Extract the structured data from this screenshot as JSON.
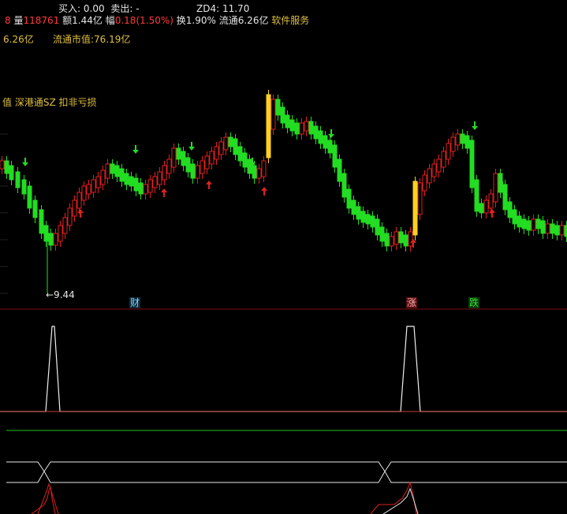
{
  "header": {
    "buy_label": "买入:",
    "buy_value": "0.00",
    "sell_label": "卖出:",
    "sell_value": "-",
    "zd4_label": "ZD4:",
    "zd4_value": "11.70",
    "row2_prefix": "8",
    "volume_label": "量",
    "volume_value": "118761",
    "amount_label": "额",
    "amount_value": "1.44亿",
    "amplitude_label": "幅",
    "amplitude_value": "0.18(1.50%)",
    "turnover_label": "换",
    "turnover_value": "1.90%",
    "float_label": "流通",
    "float_value": "6.26亿",
    "sector": "软件服务",
    "row3_left": "6.26亿",
    "float_mktcap_label": "流通市值:",
    "float_mktcap_value": "76.19亿"
  },
  "tags": {
    "prefix": "值",
    "stock_connect": "深港通SZ",
    "loss": "扣非亏损"
  },
  "annotations": {
    "low_price": "←9.44",
    "events": [
      "财",
      "涨",
      "跌"
    ]
  },
  "colors": {
    "background": "#000000",
    "up": "#e02020",
    "down": "#22dd22",
    "limit": "#ffd020",
    "separator": "#7a1010",
    "green_line": "#1a9a1a"
  },
  "chart_data": {
    "type": "candlestick",
    "price_axis_visible": false,
    "low_marker": 9.44,
    "arrows_down": [
      5,
      34,
      47,
      63,
      82,
      116,
      125
    ],
    "arrows_up": [
      19,
      40,
      52,
      66,
      103,
      122
    ],
    "indicator_spikes": [
      13,
      102
    ]
  }
}
